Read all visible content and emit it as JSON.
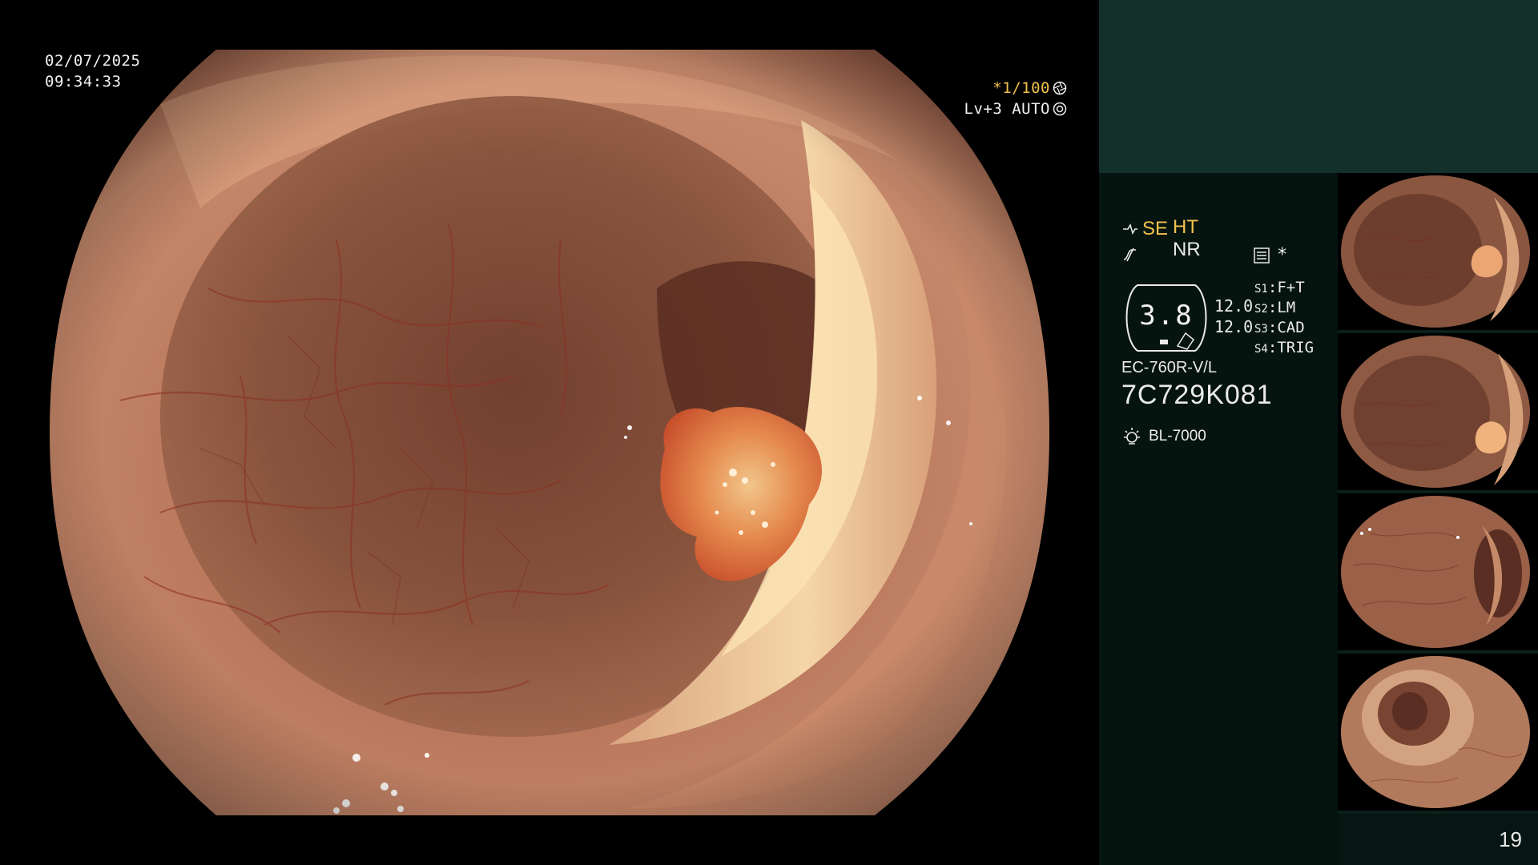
{
  "overlay": {
    "date": "02/07/2025",
    "time": "09:34:33",
    "shutter": "*1/100",
    "level_mode": "Lv+3 AUTO"
  },
  "panel": {
    "mode_primary": "HT",
    "mode_secondary": "NR",
    "structure_mode": "SE",
    "zoom": "3.8",
    "value_top": "12.0",
    "value_bottom": "12.0",
    "star": "*",
    "slots": [
      {
        "id": "S1",
        "value": "F+T"
      },
      {
        "id": "S2",
        "value": "LM"
      },
      {
        "id": "S3",
        "value": "CAD"
      },
      {
        "id": "S4",
        "value": "TRIG"
      }
    ],
    "scope_model": "EC-760R-V/L",
    "scope_serial": "7C729K081",
    "light_source": "BL-7000",
    "page_number": "19"
  },
  "colors": {
    "mucosa": "#c48466",
    "mucosa_dark": "#6e3c2c",
    "fold_highlight": "#f0cfa0",
    "polyp": "#e06a3a",
    "panel_bg": "#071613",
    "panel_header": "#13302b",
    "osd_yellow": "#f2c14e"
  },
  "icons": [
    "aperture-icon",
    "iris-icon",
    "gain-icon",
    "freeze-icon",
    "memo-icon",
    "lamp-icon"
  ]
}
